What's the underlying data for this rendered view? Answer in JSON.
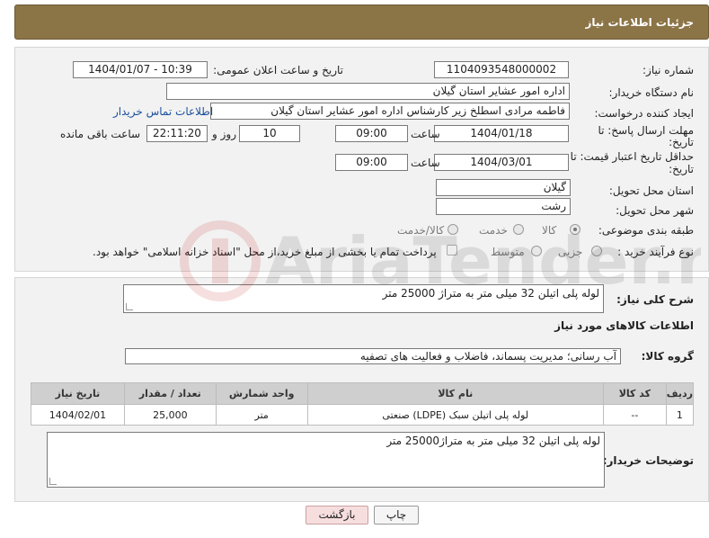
{
  "header": {
    "title": "جزئیات اطلاعات نیاز"
  },
  "form": {
    "need_number": {
      "label": "شماره نیاز:",
      "value": "1104093548000002"
    },
    "announce": {
      "label": "تاریخ و ساعت اعلان عمومی:",
      "value": "1404/01/07 - 10:39"
    },
    "buyer_org": {
      "label": "نام دستگاه خریدار:",
      "value": "اداره امور عشایر استان گیلان"
    },
    "creator": {
      "label": "ایجاد کننده درخواست:",
      "value": "فاطمه مرادی اسطلخ زیر کارشناس اداره امور عشایر استان گیلان",
      "contact_link": "اطلاعات تماس خریدار"
    },
    "deadline": {
      "label_line1": "مهلت ارسال پاسخ: تا",
      "label_line2": "تاریخ:",
      "date": "1404/01/18",
      "time_label": "ساعت",
      "time": "09:00",
      "days": "10",
      "days_label": "روز و",
      "remaining": "22:11:20",
      "remaining_label": "ساعت باقی مانده"
    },
    "validity": {
      "label_line1": "حداقل تاریخ اعتبار قیمت: تا",
      "label_line2": "تاریخ:",
      "date": "1404/03/01",
      "time_label": "ساعت",
      "time": "09:00"
    },
    "province": {
      "label": "استان محل تحویل:",
      "value": "گیلان"
    },
    "city": {
      "label": "شهر محل تحویل:",
      "value": "رشت"
    },
    "category": {
      "label": "طبقه بندی موضوعی:",
      "options": [
        "کالا",
        "خدمت",
        "کالا/خدمت"
      ],
      "selected": "کالا"
    },
    "process": {
      "label": "نوع فرآیند خرید :",
      "options": [
        "جزیی",
        "متوسط"
      ],
      "selected": "",
      "payment_note": "پرداخت تمام یا بخشی از مبلغ خرید،از محل \"اسناد خزانه اسلامی\" خواهد بود."
    }
  },
  "description": {
    "label": "شرح کلی نیاز:",
    "value": "لوله پلی اتیلن 32 میلی متر به متراژ 25000 متر"
  },
  "goods": {
    "title": "اطلاعات کالاهای مورد نیاز",
    "group_label": "گروه کالا:",
    "group_value": "آب رسانی؛ مدیریت پسماند، فاضلاب و فعالیت های تصفیه",
    "columns": [
      "ردیف",
      "کد کالا",
      "نام کالا",
      "واحد شمارش",
      "تعداد / مقدار",
      "تاریخ نیاز"
    ],
    "rows": [
      {
        "row": "1",
        "code": "--",
        "name": "لوله پلی اتیلن سبک (LDPE) صنعتی",
        "unit": "متر",
        "qty": "25,000",
        "date": "1404/02/01"
      }
    ]
  },
  "buyer_notes": {
    "label": "توضیحات خریدار:",
    "value": "لوله پلی اتیلن 32 میلی متر به متراژ25000 متر"
  },
  "buttons": {
    "print": "چاپ",
    "back": "بازگشت"
  },
  "watermark": {
    "text": "AriaTender.neT"
  }
}
